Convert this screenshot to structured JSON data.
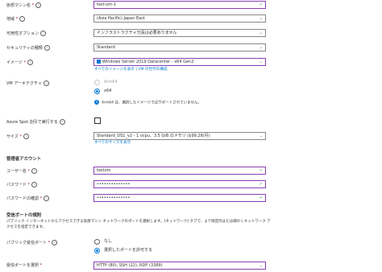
{
  "fields": {
    "vm_name": {
      "label": "仮想マシン名",
      "value": "test-vm-1"
    },
    "region": {
      "label": "地域",
      "value": "(Asia Pacific) Japan East"
    },
    "availability": {
      "label": "可用性オプション",
      "value": "インフラストラクチャ冗長は必要ありません"
    },
    "security_type": {
      "label": "セキュリティの種類",
      "value": "Standard"
    },
    "image": {
      "label": "イメージ",
      "value": "Windows Server 2019 Datacenter - x64 Gen2",
      "link": "すべてのイメージを表示 | VM の世代の構成"
    },
    "vm_arch": {
      "label": "VM アーキテクチャ",
      "options": [
        "Arm64",
        "x64"
      ],
      "selected": "x64",
      "info": "Arm64 は、選択したイメージではサポートされていません。"
    },
    "spot": {
      "label": "Azure Spot 割引で実行する"
    },
    "size": {
      "label": "サイズ",
      "value": "Standard_DS1_v2 - 1 vcpu、3.5 GiB のメモリ ($99.28/月)",
      "link": "すべてのサイズを表示"
    }
  },
  "admin": {
    "heading": "管理者アカウント",
    "username": {
      "label": "ユーザー名",
      "value": "testvm"
    },
    "password": {
      "label": "パスワード",
      "value": "••••••••••••••"
    },
    "password_confirm": {
      "label": "パスワードの確認",
      "value": "••••••••••••••"
    }
  },
  "inbound": {
    "heading": "受信ポートの規則",
    "description": "パブリック インターネットからアクセスできる仮想マシン ネットワークのポートを選択します。[ネットワーク] タブで、より限定的または細かくネットワーク アクセスを指定できます。",
    "public_ports": {
      "label": "パブリック受信ポート",
      "options": [
        "なし",
        "選択したポートを許可する"
      ],
      "selected": "選択したポートを許可する"
    },
    "select_ports": {
      "label": "受信ポートを選択",
      "value": "HTTP (80), SSH (22), RDP (3389)"
    }
  },
  "colors": {
    "accent": "#0078d4",
    "focus": "#8b3fb3",
    "valid": "#107c10"
  }
}
